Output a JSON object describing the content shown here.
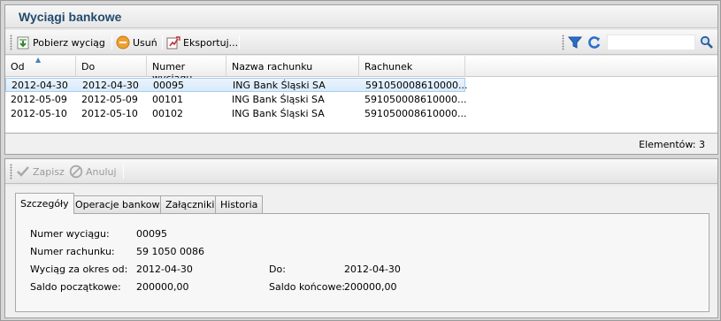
{
  "window": {
    "title": "Wyciągi bankowe"
  },
  "toolbar": {
    "fetch_label": "Pobierz wyciąg",
    "delete_label": "Usuń",
    "export_label": "Eksportuj...",
    "search_placeholder": ""
  },
  "icons": {
    "fetch": "download-icon",
    "delete": "delete-icon",
    "export": "export-icon",
    "filter": "filter-icon",
    "refresh": "refresh-icon",
    "search": "search-icon",
    "save": "checkmark-icon",
    "cancel": "cancel-icon"
  },
  "grid": {
    "columns": [
      "Od",
      "Do",
      "Numer wyciągu",
      "Nazwa rachunku",
      "Rachunek"
    ],
    "sort_column": "Od",
    "rows": [
      [
        "2012-04-30",
        "2012-04-30",
        "00095",
        "ING Bank Śląski SA",
        "591050008610000..."
      ],
      [
        "2012-05-09",
        "2012-05-09",
        "00101",
        "ING Bank Śląski SA",
        "591050008610000..."
      ],
      [
        "2012-05-10",
        "2012-05-10",
        "00102",
        "ING Bank Śląski SA",
        "591050008610000..."
      ]
    ],
    "selected_row": 0
  },
  "status": {
    "count_text": "Elementów: 3"
  },
  "edit_toolbar": {
    "save_label": "Zapisz",
    "cancel_label": "Anuluj"
  },
  "tabs": [
    "Szczegóły",
    "Operacje bankowe",
    "Załączniki",
    "Historia"
  ],
  "active_tab": "Szczegóły",
  "details": {
    "statement_number_label": "Numer wyciągu:",
    "statement_number": "00095",
    "account_number_label": "Numer rachunku:",
    "account_number": "59 1050 0086",
    "period_from_label": "Wyciąg za okres od:",
    "period_from": "2012-04-30",
    "period_to_label": "Do:",
    "period_to": "2012-04-30",
    "opening_balance_label": "Saldo początkowe:",
    "opening_balance": "200000,00",
    "closing_balance_label": "Saldo końcowe:",
    "closing_balance": "200000,00"
  },
  "colors": {
    "title": "#234a6e",
    "selection": "#d8eafb",
    "accent": "#2a6fc9"
  }
}
